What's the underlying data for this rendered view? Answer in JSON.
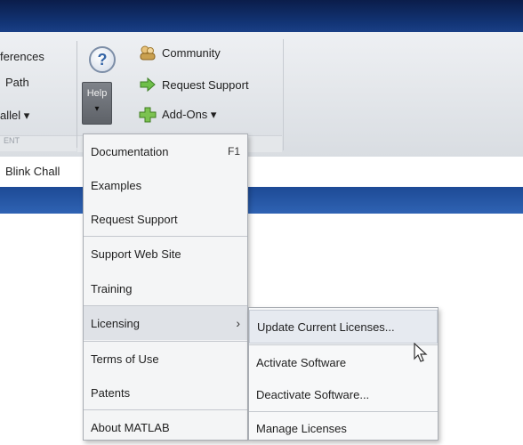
{
  "ribbon": {
    "left_group": {
      "items": [
        "ferences",
        "Path",
        "allel ▾"
      ],
      "caption": "ENT"
    },
    "help": {
      "label": "Help",
      "caret": "▾",
      "icon": "question-icon"
    },
    "resources": {
      "community": "Community",
      "request_support": "Request Support",
      "add_ons": "Add-Ons ▾"
    }
  },
  "tabrow": {
    "tab_label": "Blink Chall"
  },
  "help_menu": {
    "documentation": {
      "label": "Documentation",
      "shortcut": "F1"
    },
    "examples": "Examples",
    "request_support": "Request Support",
    "support_web_site": "Support Web Site",
    "training": "Training",
    "licensing": {
      "label": "Licensing",
      "arrow": "›"
    },
    "terms_of_use": "Terms of Use",
    "patents": "Patents",
    "about": "About MATLAB"
  },
  "licensing_submenu": {
    "update": "Update Current Licenses...",
    "activate": "Activate Software",
    "deactivate": "Deactivate Software...",
    "manage": "Manage Licenses"
  },
  "colors": {
    "title_bar": "#123475",
    "ribbon_bg": "#e6e9ed",
    "help_button": "#6a6e74",
    "blue_band": "#2a5aa8"
  }
}
